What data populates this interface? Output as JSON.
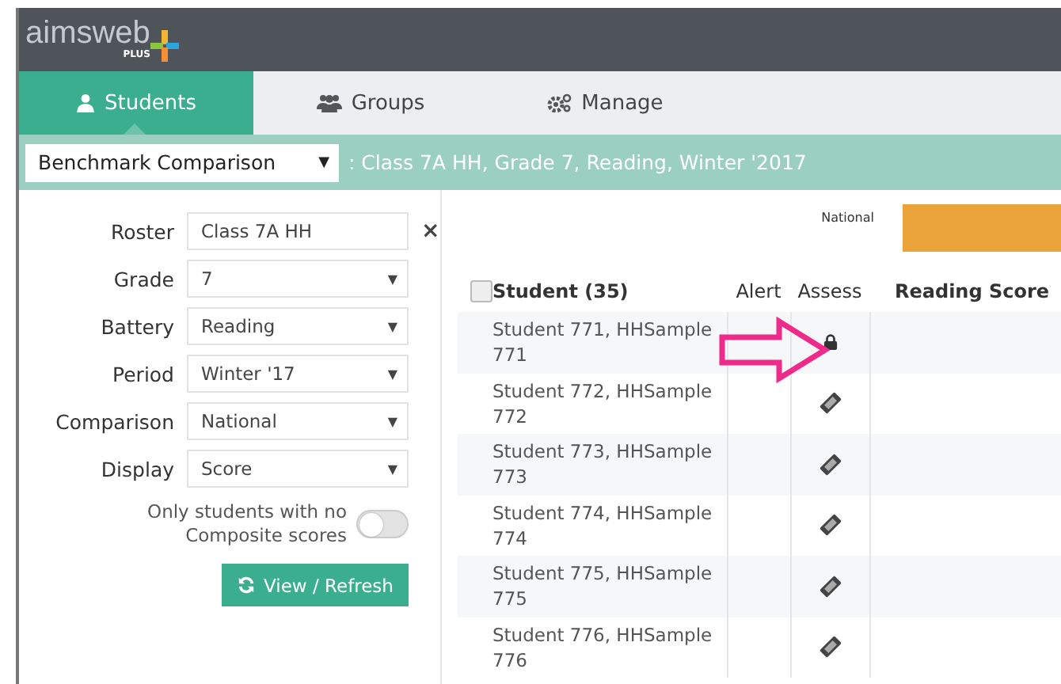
{
  "header": {
    "logo": "aimsweb",
    "logo_sub": "PLUS"
  },
  "tabs": [
    {
      "label": "Students",
      "selected": true
    },
    {
      "label": "Groups",
      "selected": false
    },
    {
      "label": "Manage",
      "selected": false
    }
  ],
  "report": {
    "value": "Benchmark Comparison",
    "caret": "▼",
    "context": ": Class 7A HH, Grade 7, Reading, Winter '2017"
  },
  "filters": [
    {
      "label": "Roster",
      "value": "Class 7A HH",
      "kind": "clearable",
      "clear": "×"
    },
    {
      "label": "Grade",
      "value": "7",
      "kind": "select",
      "caret": "▼"
    },
    {
      "label": "Battery",
      "value": "Reading",
      "kind": "select",
      "caret": "▼"
    },
    {
      "label": "Period",
      "value": "Winter '17",
      "kind": "select",
      "caret": "▼"
    },
    {
      "label": "Comparison",
      "value": "National",
      "kind": "select",
      "caret": "▼"
    },
    {
      "label": "Display",
      "value": "Score",
      "kind": "select",
      "caret": "▼"
    }
  ],
  "toggle": {
    "label": "Only students with no Composite scores",
    "on": false
  },
  "refresh_button": "View / Refresh",
  "legend": {
    "label": "National",
    "color": "#eaa43a"
  },
  "table": {
    "columns": [
      "Student (35)",
      "Alert",
      "Assess",
      "Reading Score"
    ],
    "all_checked": false,
    "rows": [
      {
        "student": "Student 771, HHSample 771",
        "locked": true
      },
      {
        "student": "Student 772, HHSample 772",
        "locked": false
      },
      {
        "student": "Student 773, HHSample 773",
        "locked": false
      },
      {
        "student": "Student 774, HHSample 774",
        "locked": false
      },
      {
        "student": "Student 775, HHSample 775",
        "locked": false
      },
      {
        "student": "Student 776, HHSample 776",
        "locked": false
      }
    ]
  }
}
